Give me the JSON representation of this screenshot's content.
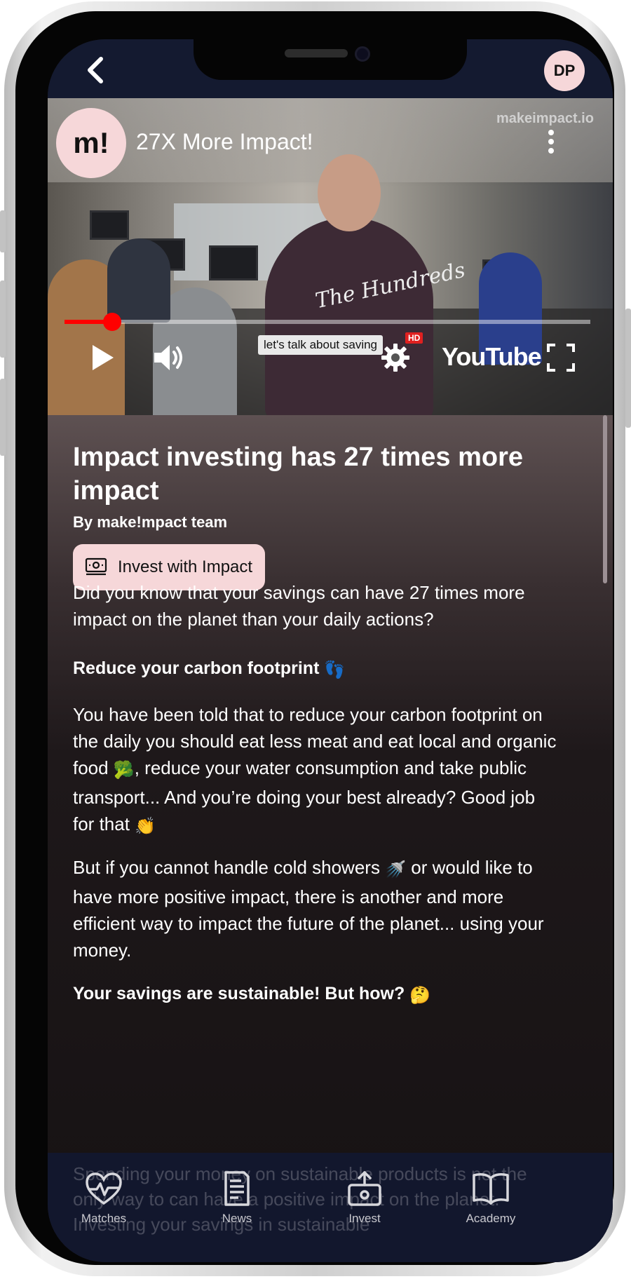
{
  "header": {
    "avatar_initials": "DP"
  },
  "video": {
    "channel_logo": "m!",
    "title": "27X More Impact!",
    "watermark": "makeimpact.io",
    "hoodie_text": "The Hundreds",
    "caption_tooltip": "let's talk about saving",
    "quality_badge": "HD",
    "platform_label": "YouTube",
    "progress_fraction": 0.09
  },
  "article": {
    "title": "Impact investing has 27 times more impact",
    "author": "By make!mpact team",
    "cta_label": "Invest with Impact",
    "intro": "Did you know that your savings can have 27 times more impact on the planet than your daily actions?",
    "heading_1": "Reduce your carbon footprint",
    "heading_1_emoji": "👣",
    "para_1a": "You have been told that to reduce your carbon footprint on the daily you should eat less meat and eat local and organic food",
    "para_1_emoji_a": "🥦",
    "para_1b": ", reduce your water consumption and take public transport... And you’re doing your best already? Good job for that",
    "para_1_emoji_b": "👏",
    "para_2a": "But if you cannot handle cold showers",
    "para_2_emoji": "🚿",
    "para_2b": "or would like to have more positive impact, there is another and more efficient way to impact the future of the planet... using your money.",
    "heading_2": "Your savings are sustainable! But how?",
    "heading_2_emoji": "🤔",
    "faded_text": "Spending your money on sustainable products is not the only way to can have a positive impact on the planet. Investing your savings in sustainable"
  },
  "nav": {
    "items": [
      {
        "label": "Matches",
        "icon": "heart-pulse-icon"
      },
      {
        "label": "News",
        "icon": "newspaper-icon"
      },
      {
        "label": "Invest",
        "icon": "invest-box-icon"
      },
      {
        "label": "Academy",
        "icon": "book-icon"
      }
    ]
  },
  "colors": {
    "accent_pink": "#f6d7d9",
    "youtube_red": "#ff0000",
    "nav_background": "#121830"
  }
}
